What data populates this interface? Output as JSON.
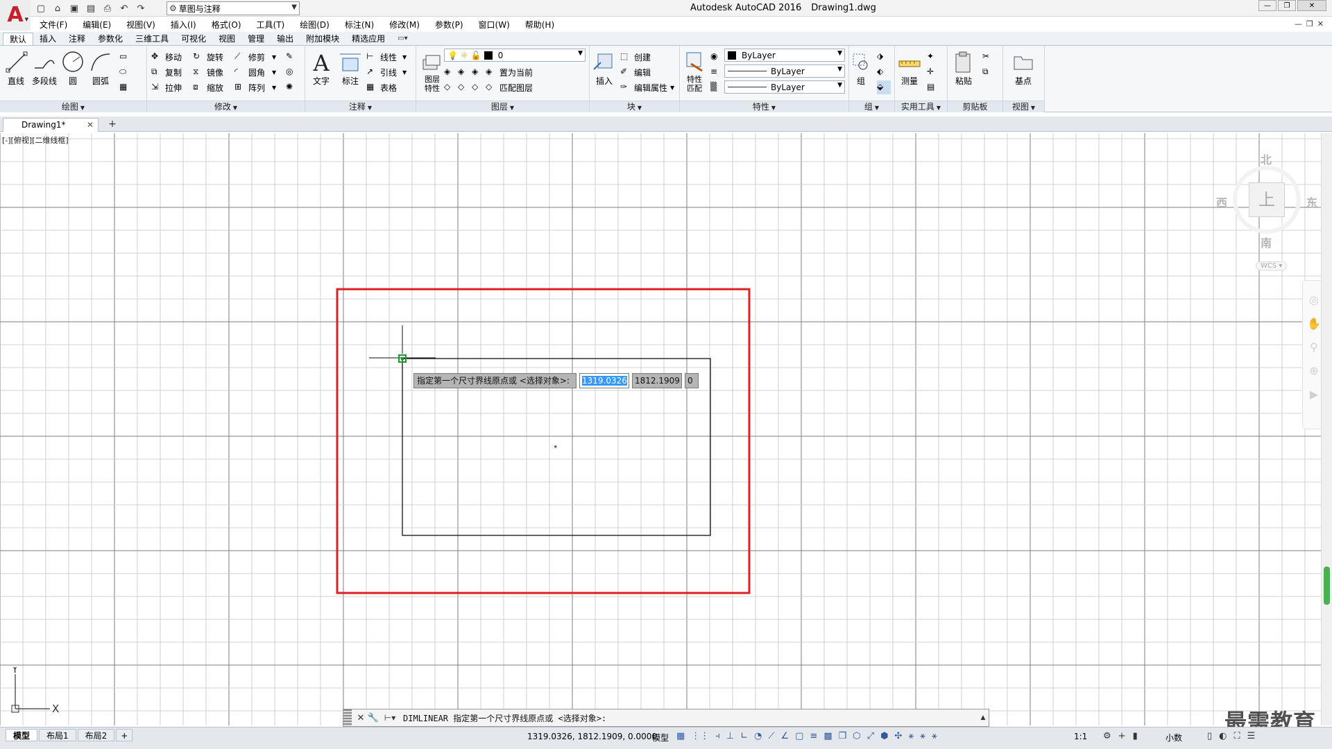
{
  "app": {
    "title": "Autodesk AutoCAD 2016",
    "document": "Drawing1.dwg",
    "workspace": "草图与注释"
  },
  "menu": [
    "文件(F)",
    "编辑(E)",
    "视图(V)",
    "插入(I)",
    "格式(O)",
    "工具(T)",
    "绘图(D)",
    "标注(N)",
    "修改(M)",
    "参数(P)",
    "窗口(W)",
    "帮助(H)"
  ],
  "ribbon_tabs": [
    "默认",
    "插入",
    "注释",
    "参数化",
    "三维工具",
    "可视化",
    "视图",
    "管理",
    "输出",
    "附加模块",
    "精选应用"
  ],
  "ribbon": {
    "draw": {
      "label": "绘图",
      "line": "直线",
      "polyline": "多段线",
      "circle": "圆",
      "arc": "圆弧"
    },
    "modify": {
      "label": "修改",
      "move": "移动",
      "rotate": "旋转",
      "trim": "修剪",
      "copy": "复制",
      "mirror": "镜像",
      "fillet": "圆角",
      "stretch": "拉伸",
      "scale": "缩放",
      "array": "阵列"
    },
    "annotation": {
      "label": "注释",
      "text": "文字",
      "dimension": "标注",
      "linear": "线性",
      "leader": "引线",
      "table": "表格"
    },
    "layers": {
      "label": "图层",
      "properties": "图层\n特性",
      "layer_value": "0",
      "set_current": "置为当前",
      "match_layer": "匹配图层"
    },
    "block": {
      "label": "块",
      "insert": "插入",
      "create": "创建",
      "edit": "编辑",
      "edit_attr": "编辑属性"
    },
    "properties": {
      "label": "特性",
      "match": "特性\n匹配",
      "color": "ByLayer",
      "linetype": "ByLayer",
      "lineweight": "ByLayer"
    },
    "groups": {
      "label": "组",
      "group": "组"
    },
    "utilities": {
      "label": "实用工具",
      "measure": "测量"
    },
    "clipboard": {
      "label": "剪贴板",
      "paste": "粘贴"
    },
    "view": {
      "label": "视图",
      "base": "基点"
    }
  },
  "file_tab": "Drawing1*",
  "viewport_label": "[-][俯视][二维线框]",
  "viewcube": {
    "north": "北",
    "south": "南",
    "east": "东",
    "west": "西",
    "top": "上",
    "wcs": "WCS"
  },
  "dynamic_input": {
    "prompt": "指定第一个尺寸界线原点或 <选择对象>:",
    "x": "1319.0326",
    "y": "1812.1909",
    "z": "0"
  },
  "command_line": {
    "text": "DIMLINEAR 指定第一个尺寸界线原点或 <选择对象>:"
  },
  "status": {
    "layouts": [
      "模型",
      "布局1",
      "布局2"
    ],
    "coords": "1319.0326, 1812.1909, 0.0000",
    "model": "模型",
    "scale": "1:1",
    "units": "小数"
  },
  "ucs": {
    "x": "X",
    "y": "Y"
  },
  "watermark": "最需教育",
  "colors": {
    "highlight_frame": "#e02020",
    "cursor_box": "#1a9a2a",
    "selection": "#3399ff"
  }
}
